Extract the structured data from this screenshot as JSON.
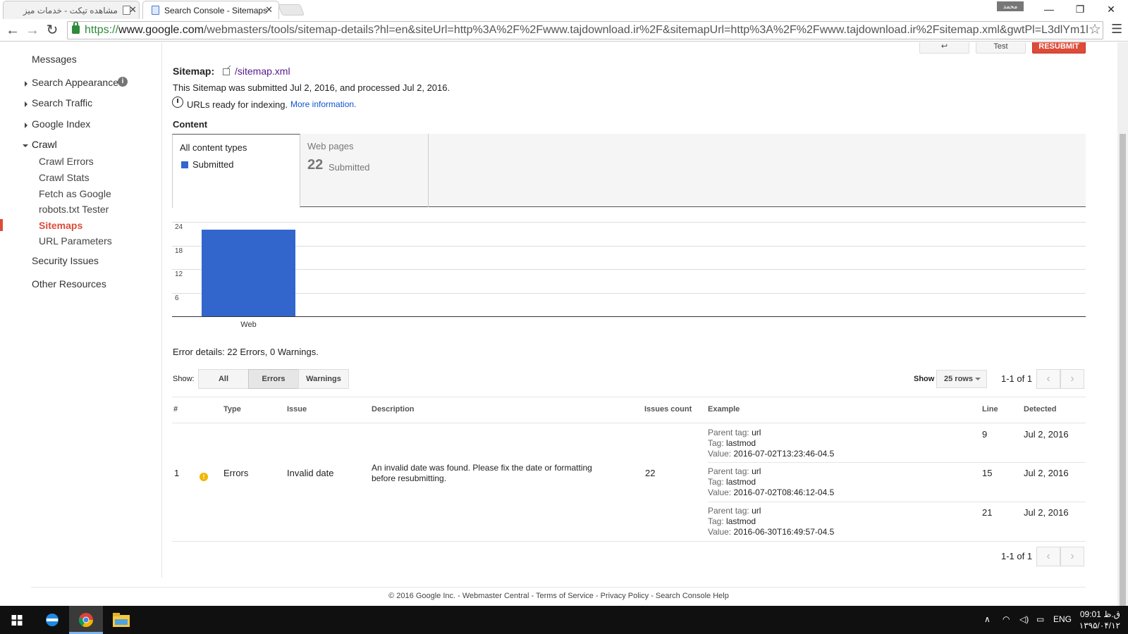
{
  "browser": {
    "tabs": [
      {
        "label": "مشاهده تیکت - خدمات میز",
        "active": false
      },
      {
        "label": "Search Console - Sitemaps",
        "active": true
      }
    ],
    "profile_name": "محمد",
    "url_scheme": "https://",
    "url_host": "www.google.com",
    "url_path": "/webmasters/tools/sitemap-details?hl=en&siteUrl=http%3A%2F%2Fwww.tajdownload.ir%2F&sitemapUrl=http%3A%2F%2Fwww.tajdownload.ir%2Fsitemap.xml&gwtPl=L3dlYm1l",
    "window_controls": {
      "minimize": "—",
      "maximize": "❐",
      "close": "✕"
    }
  },
  "sidebar": {
    "messages": "Messages",
    "search_appearance": "Search Appearance",
    "search_traffic": "Search Traffic",
    "google_index": "Google Index",
    "crawl": "Crawl",
    "crawl_items": [
      "Crawl Errors",
      "Crawl Stats",
      "Fetch as Google",
      "robots.txt Tester",
      "Sitemaps",
      "URL Parameters"
    ],
    "active_item": "Sitemaps",
    "security_issues": "Security Issues",
    "other_resources": "Other Resources"
  },
  "top_buttons": {
    "back": "↩",
    "test": "Test",
    "resubmit": "RESUBMIT"
  },
  "sitemap": {
    "label": "Sitemap:",
    "path": "/sitemap.xml",
    "submitted_text": "This Sitemap was submitted Jul 2, 2016, and processed Jul 2, 2016.",
    "indexing_text": "URLs ready for indexing.",
    "more_info": "More information."
  },
  "content": {
    "heading": "Content",
    "all_types_label": "All content types",
    "legend_submitted": "Submitted",
    "web_pages_label": "Web pages",
    "web_pages_count": "22",
    "web_pages_status": "Submitted"
  },
  "colors": {
    "series_submitted": "#3366cc",
    "accent_red": "#dd4b39",
    "link": "#1155cc",
    "warning": "#f4b400"
  },
  "chart_data": {
    "type": "bar",
    "categories": [
      "Web"
    ],
    "series": [
      {
        "name": "Submitted",
        "values": [
          22
        ]
      }
    ],
    "yticks": [
      6,
      12,
      18,
      24
    ],
    "ylim": [
      0,
      24
    ],
    "grid": true
  },
  "errors": {
    "summary": "Error details: 22 Errors, 0 Warnings.",
    "show_label": "Show:",
    "filters": [
      "All",
      "Errors",
      "Warnings"
    ],
    "active_filter": "Errors",
    "rows_label": "Show",
    "rows_value": "25 rows",
    "pagination": "1-1 of 1",
    "prev": "‹",
    "next": "›",
    "columns": [
      "#",
      "Type",
      "Issue",
      "Description",
      "Issues count",
      "Example",
      "Line",
      "Detected"
    ],
    "row": {
      "num": "1",
      "type": "Errors",
      "issue": "Invalid date",
      "description_line1": "An invalid date was found. Please fix the date or formatting",
      "description_line2": "before resubmitting.",
      "count": "22",
      "examples": [
        {
          "parent_label": "Parent tag:",
          "parent": "url",
          "tag_label": "Tag:",
          "tag": "lastmod",
          "value_label": "Value:",
          "value": "2016-07-02T13:23:46-04.5",
          "line": "9",
          "detected": "Jul 2, 2016"
        },
        {
          "parent_label": "Parent tag:",
          "parent": "url",
          "tag_label": "Tag:",
          "tag": "lastmod",
          "value_label": "Value:",
          "value": "2016-07-02T08:46:12-04.5",
          "line": "15",
          "detected": "Jul 2, 2016"
        },
        {
          "parent_label": "Parent tag:",
          "parent": "url",
          "tag_label": "Tag:",
          "tag": "lastmod",
          "value_label": "Value:",
          "value": "2016-06-30T16:49:57-04.5",
          "line": "21",
          "detected": "Jul 2, 2016"
        }
      ]
    }
  },
  "footer": "© 2016 Google Inc. - Webmaster Central - Terms of Service - Privacy Policy - Search Console Help",
  "taskbar": {
    "language": "ENG",
    "time": "09:01 ق.ظ",
    "date": "۱۳۹۵/۰۴/۱۲"
  }
}
